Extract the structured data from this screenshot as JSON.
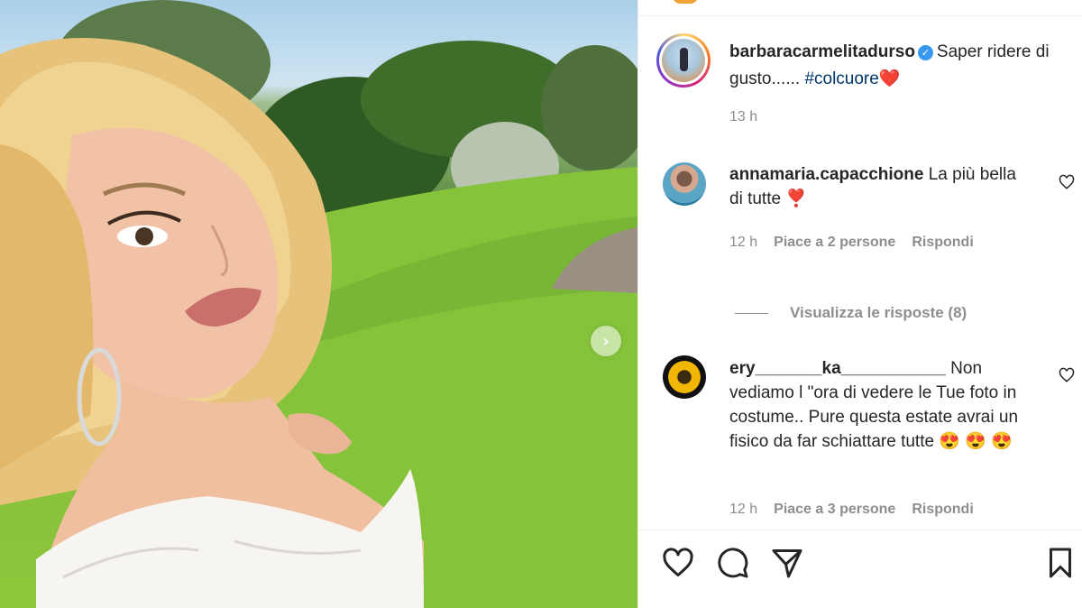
{
  "post": {
    "author": "barbaracarmelitadurso",
    "caption_text": "Saper ridere di gusto...... ",
    "hashtag": "#colcuore",
    "caption_emoji": "❤️",
    "time": "13 h"
  },
  "comments": [
    {
      "user": "annamaria.capacchione",
      "text": "La più bella di tutte ❣️",
      "time": "12 h",
      "likes": "Piace a 2 persone",
      "reply_label": "Rispondi"
    },
    {
      "user": "ery_______ka___________",
      "text": "Non vediamo l \"ora di vedere le Tue foto in costume.. Pure questa estate avrai un fisico da far schiattare tutte 😍 😍 😍",
      "time": "12 h",
      "likes": "Piace a 3 persone",
      "reply_label": "Rispondi"
    }
  ],
  "view_replies": "Visualizza le risposte (8)",
  "icons": {
    "verified": "verified-badge-icon",
    "next": "chevron-right-icon",
    "like": "heart-icon",
    "comment": "comment-icon",
    "share": "paper-plane-icon",
    "save": "bookmark-icon"
  },
  "colors": {
    "hashtag": "#00376b",
    "secondary_text": "#8e8e8e",
    "verified": "#3897f0"
  }
}
